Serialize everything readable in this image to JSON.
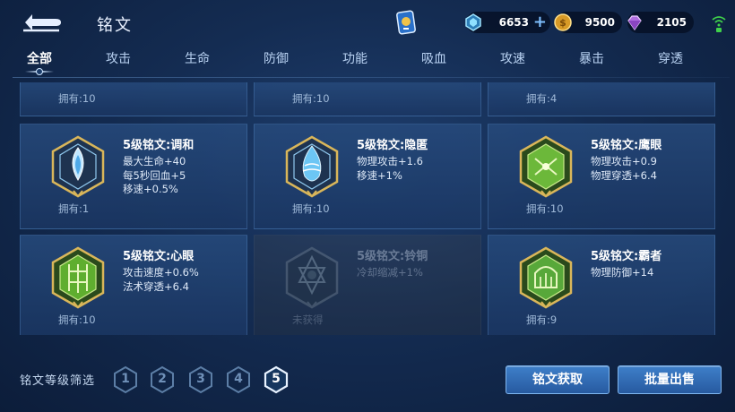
{
  "header": {
    "title": "铭文",
    "resources": {
      "coupon": {
        "value": "6653",
        "icon": "diamond-coupon-icon"
      },
      "gold": {
        "value": "9500",
        "icon": "gold-coin-icon"
      },
      "gem": {
        "value": "2105",
        "icon": "gem-icon"
      }
    }
  },
  "tabs": [
    {
      "label": "全部",
      "active": true
    },
    {
      "label": "攻击"
    },
    {
      "label": "生命"
    },
    {
      "label": "防御"
    },
    {
      "label": "功能"
    },
    {
      "label": "吸血"
    },
    {
      "label": "攻速"
    },
    {
      "label": "暴击"
    },
    {
      "label": "穿透"
    }
  ],
  "partial_row": [
    {
      "owned": "拥有:10"
    },
    {
      "owned": "拥有:10"
    },
    {
      "owned": "拥有:4"
    }
  ],
  "runes": [
    {
      "name": "5级铭文:调和",
      "stats": [
        "最大生命+40",
        "每5秒回血+5",
        "移速+0.5%"
      ],
      "owned": "拥有:1",
      "color": "#4fa9e8",
      "locked": false
    },
    {
      "name": "5级铭文:隐匿",
      "stats": [
        "物理攻击+1.6",
        "移速+1%"
      ],
      "owned": "拥有:10",
      "color": "#3fa0e0",
      "locked": false
    },
    {
      "name": "5级铭文:鹰眼",
      "stats": [
        "物理攻击+0.9",
        "物理穿透+6.4"
      ],
      "owned": "拥有:10",
      "color": "#6cb83a",
      "locked": false
    },
    {
      "name": "5级铭文:心眼",
      "stats": [
        "攻击速度+0.6%",
        "法术穿透+6.4"
      ],
      "owned": "拥有:10",
      "color": "#5fae2f",
      "locked": false
    },
    {
      "name": "5级铭文:铃铜",
      "stats": [
        "冷却缩减+1%"
      ],
      "owned": "未获得",
      "color": "#4f8f6a",
      "locked": true
    },
    {
      "name": "5级铭文:霸者",
      "stats": [
        "物理防御+14"
      ],
      "owned": "拥有:9",
      "color": "#58a83a",
      "locked": false
    }
  ],
  "footer": {
    "filter_label": "铭文等级筛选",
    "levels": [
      "1",
      "2",
      "3",
      "4",
      "5"
    ],
    "selected_level": "5",
    "get_button": "铭文获取",
    "sell_button": "批量出售"
  }
}
